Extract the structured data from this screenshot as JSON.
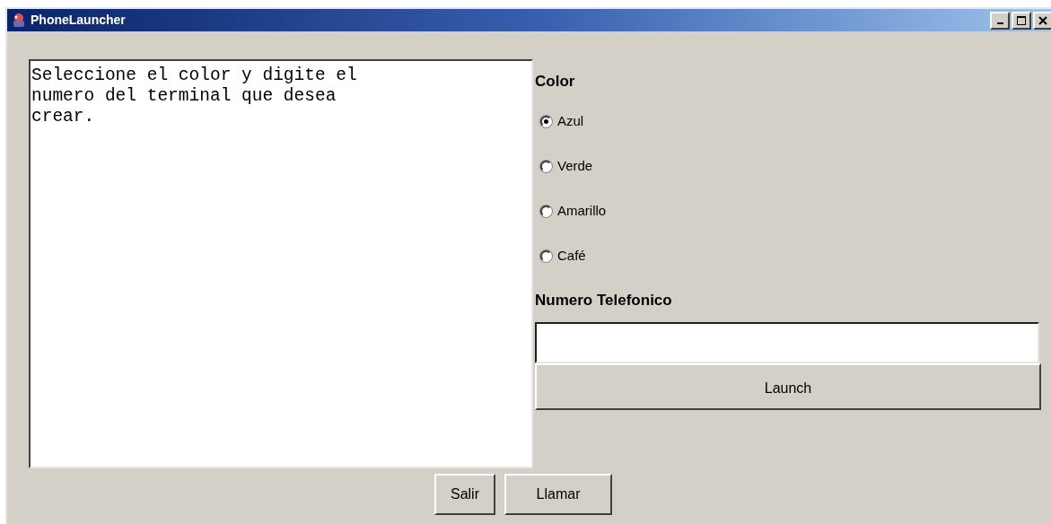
{
  "window": {
    "title": "PhoneLauncher"
  },
  "message": {
    "lines": [
      "Seleccione el color y digite el",
      "numero del terminal que desea",
      "crear."
    ]
  },
  "color": {
    "label": "Color",
    "options": [
      {
        "label": "Azul",
        "selected": true
      },
      {
        "label": "Verde",
        "selected": false
      },
      {
        "label": "Amarillo",
        "selected": false
      },
      {
        "label": "Café",
        "selected": false
      }
    ]
  },
  "phone": {
    "label": "Numero Telefonico"
  },
  "launch_button": "Launch",
  "buttons": [
    "Salir",
    "Llamar"
  ]
}
